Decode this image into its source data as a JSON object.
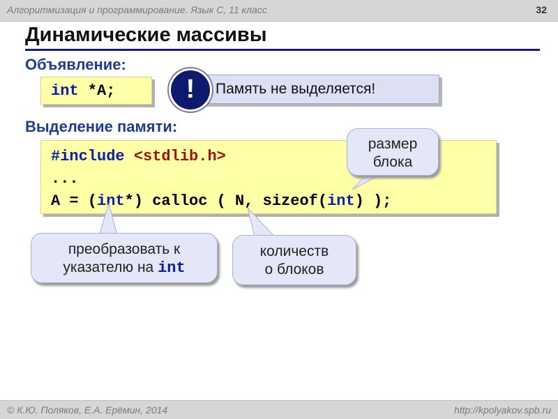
{
  "header": {
    "course": "Алгоритмизация и программирование. Язык С, 11 класс",
    "page_number": "32"
  },
  "title": "Динамические массивы",
  "declaration": {
    "heading": "Объявление:",
    "code_kw": "int",
    "code_rest": " *A;",
    "bang": "!",
    "note": "Память не выделяется!"
  },
  "allocation": {
    "heading": "Выделение памяти:",
    "line1_directive": "#include",
    "line1_header": "<stdlib.h>",
    "line2": "...",
    "line3": {
      "p1": "A = (",
      "kw1": "int",
      "p2": "*) calloc ( N, sizeof(",
      "kw2": "int",
      "p3": ") );"
    }
  },
  "callouts": {
    "block_size": [
      "размер",
      "блока"
    ],
    "cast": {
      "line1": "преобразовать к",
      "line2_text": "указателю на ",
      "line2_kw": "int"
    },
    "count": [
      "количеств",
      "о блоков"
    ]
  },
  "footer": {
    "authors": "© К.Ю. Поляков, Е.А. Ерёмин, 2014",
    "url": "http://kpolyakov.spb.ru"
  },
  "colors": {
    "heading": "#1f3d8c",
    "keyword": "#0b20a8",
    "string": "#a0100a",
    "code_bg": "#ffffa8",
    "note_bg": "#dde0f2"
  }
}
